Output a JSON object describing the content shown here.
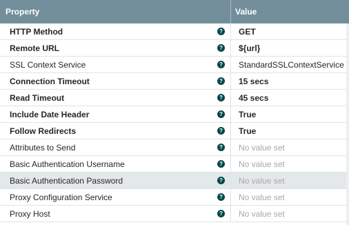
{
  "header": {
    "property": "Property",
    "value": "Value"
  },
  "rows": [
    {
      "name": "HTTP Method",
      "value": "GET",
      "required": true,
      "empty": false
    },
    {
      "name": "Remote URL",
      "value": "${url}",
      "required": true,
      "empty": false
    },
    {
      "name": "SSL Context Service",
      "value": "StandardSSLContextService",
      "required": false,
      "empty": false
    },
    {
      "name": "Connection Timeout",
      "value": "15 secs",
      "required": true,
      "empty": false
    },
    {
      "name": "Read Timeout",
      "value": "45 secs",
      "required": true,
      "empty": false
    },
    {
      "name": "Include Date Header",
      "value": "True",
      "required": true,
      "empty": false
    },
    {
      "name": "Follow Redirects",
      "value": "True",
      "required": true,
      "empty": false
    },
    {
      "name": "Attributes to Send",
      "value": "No value set",
      "required": false,
      "empty": true
    },
    {
      "name": "Basic Authentication Username",
      "value": "No value set",
      "required": false,
      "empty": true
    },
    {
      "name": "Basic Authentication Password",
      "value": "No value set",
      "required": false,
      "empty": true,
      "highlighted": true
    },
    {
      "name": "Proxy Configuration Service",
      "value": "No value set",
      "required": false,
      "empty": true
    },
    {
      "name": "Proxy Host",
      "value": "No value set",
      "required": false,
      "empty": true
    }
  ],
  "help_icon": {
    "name": "question-circle-icon",
    "glyph": "?"
  },
  "colors": {
    "header_bg": "#728e9b",
    "help_icon": "#004849",
    "empty_text": "#a8a8a8"
  }
}
